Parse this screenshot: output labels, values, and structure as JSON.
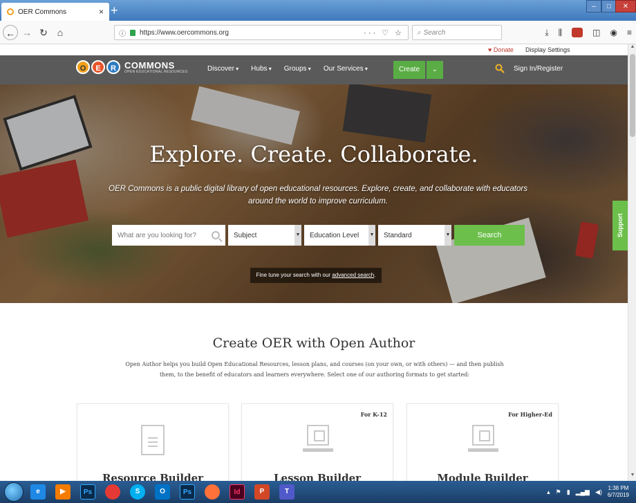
{
  "browser": {
    "tab_title": "OER Commons",
    "tab_close": "×",
    "new_tab": "+",
    "url": "https://www.oercommons.org",
    "url_actions": "··· ♡ ☆",
    "search_placeholder": "Search",
    "icons": [
      "back-icon",
      "forward-icon",
      "reload-icon",
      "home-icon",
      "info-icon",
      "lock-icon",
      "search-icon",
      "downloads-icon",
      "library-icon",
      "ublock-icon",
      "sidebar-icon",
      "menu-icon"
    ]
  },
  "utility": {
    "donate": "Donate",
    "display_settings": "Display Settings"
  },
  "header": {
    "logo_letters": [
      "O",
      "E",
      "R"
    ],
    "logo_main": "COMMONS",
    "logo_sub": "OPEN EDUCATIONAL RESOURCES",
    "menu": [
      "Discover",
      "Hubs",
      "Groups",
      "Our Services"
    ],
    "create": "Create",
    "sign_in": "Sign In/Register"
  },
  "hero": {
    "title": "Explore. Create. Collaborate.",
    "subtitle": "OER Commons is a public digital library of open educational resources. Explore, create, and collaborate with educators around the world to improve curriculum.",
    "search_placeholder": "What are you looking for?",
    "subject": "Subject",
    "education_level": "Education Level",
    "standard": "Standard",
    "search_button": "Search",
    "advanced_prefix": "Fine tune your search with our ",
    "advanced_link": "advanced search",
    "advanced_suffix": "."
  },
  "support": "Support",
  "open_author": {
    "title": "Create OER with Open Author",
    "description": "Open Author helps you build Open Educational Resources, lesson plans, and courses (on your own, or with others) — and then publish them, to the benefit of educators and learners everywhere. Select one of our authoring formats to get started:",
    "cards": [
      {
        "title": "Resource Builder",
        "badge": ""
      },
      {
        "title": "Lesson Builder",
        "badge": "For K-12"
      },
      {
        "title": "Module Builder",
        "badge": "For Higher-Ed"
      }
    ]
  },
  "taskbar": {
    "apps": [
      "Ps",
      "Ps",
      "Id",
      "P"
    ],
    "time": "1:38 PM",
    "date": "6/7/2019"
  },
  "colors": {
    "header_bg": "#5a5a5a",
    "accent_green": "#6cbf4b",
    "search_icon": "#f0b323"
  }
}
